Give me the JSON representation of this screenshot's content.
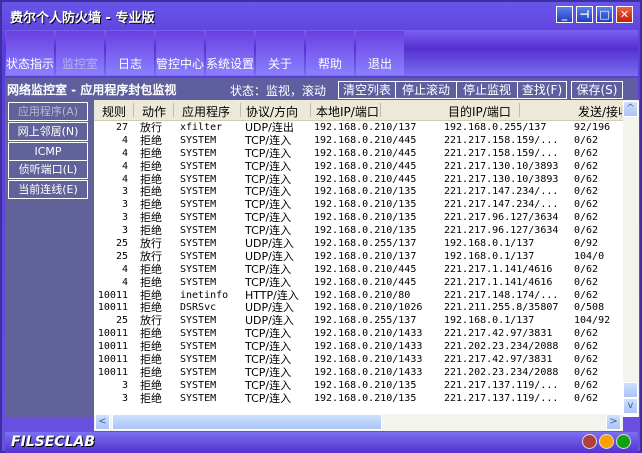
{
  "window": {
    "title": "费尔个人防火墙 - 专业版",
    "controls": [
      "minimize",
      "restore-alt",
      "maximize",
      "close"
    ]
  },
  "tabs": [
    {
      "label": "状态指示"
    },
    {
      "label": "监控室",
      "active": true
    },
    {
      "label": "日志"
    },
    {
      "label": "管控中心"
    },
    {
      "label": "系统设置"
    },
    {
      "label": "关于"
    },
    {
      "label": "帮助"
    },
    {
      "label": "退出"
    }
  ],
  "subheader": {
    "title": "网络监控室 - 应用程序封包监视",
    "status": "状态：监视，滚动",
    "buttons": [
      "清空列表",
      "停止滚动",
      "停止监视",
      "查找(F)",
      "保存(S)"
    ]
  },
  "left_menu": [
    {
      "label": "应用程序(A)",
      "active": true
    },
    {
      "label": "网上邻居(N)"
    },
    {
      "label": "ICMP"
    },
    {
      "label": "侦听端口(L)"
    },
    {
      "label": "当前连线(E)"
    }
  ],
  "table": {
    "columns": [
      "规则",
      "动作",
      "应用程序",
      "协议/方向",
      "本地IP/端口",
      "目的IP/端口",
      "发送/接收"
    ],
    "rows": [
      [
        "27",
        "放行",
        "xfilter",
        "UDP/连出",
        "192.168.0.210/137",
        "192.168.0.255/137",
        "92/196"
      ],
      [
        "4",
        "拒绝",
        "SYSTEM",
        "TCP/连入",
        "192.168.0.210/445",
        "221.217.158.159/...",
        "0/62"
      ],
      [
        "4",
        "拒绝",
        "SYSTEM",
        "TCP/连入",
        "192.168.0.210/445",
        "221.217.158.159/...",
        "0/62"
      ],
      [
        "4",
        "拒绝",
        "SYSTEM",
        "TCP/连入",
        "192.168.0.210/445",
        "221.217.130.10/3893",
        "0/62"
      ],
      [
        "4",
        "拒绝",
        "SYSTEM",
        "TCP/连入",
        "192.168.0.210/445",
        "221.217.130.10/3893",
        "0/62"
      ],
      [
        "3",
        "拒绝",
        "SYSTEM",
        "TCP/连入",
        "192.168.0.210/135",
        "221.217.147.234/...",
        "0/62"
      ],
      [
        "3",
        "拒绝",
        "SYSTEM",
        "TCP/连入",
        "192.168.0.210/135",
        "221.217.147.234/...",
        "0/62"
      ],
      [
        "3",
        "拒绝",
        "SYSTEM",
        "TCP/连入",
        "192.168.0.210/135",
        "221.217.96.127/3634",
        "0/62"
      ],
      [
        "3",
        "拒绝",
        "SYSTEM",
        "TCP/连入",
        "192.168.0.210/135",
        "221.217.96.127/3634",
        "0/62"
      ],
      [
        "25",
        "放行",
        "SYSTEM",
        "UDP/连入",
        "192.168.0.255/137",
        "192.168.0.1/137",
        "0/92"
      ],
      [
        "25",
        "放行",
        "SYSTEM",
        "UDP/连入",
        "192.168.0.210/137",
        "192.168.0.1/137",
        "104/0"
      ],
      [
        "4",
        "拒绝",
        "SYSTEM",
        "TCP/连入",
        "192.168.0.210/445",
        "221.217.1.141/4616",
        "0/62"
      ],
      [
        "4",
        "拒绝",
        "SYSTEM",
        "TCP/连入",
        "192.168.0.210/445",
        "221.217.1.141/4616",
        "0/62"
      ],
      [
        "10011",
        "拒绝",
        "inetinfo",
        "HTTP/连入",
        "192.168.0.210/80",
        "221.217.148.174/...",
        "0/62"
      ],
      [
        "10011",
        "拒绝",
        "DSRSvc",
        "UDP/连入",
        "192.168.0.210/1026",
        "221.211.255.8/35807",
        "0/508"
      ],
      [
        "25",
        "放行",
        "SYSTEM",
        "UDP/连入",
        "192.168.0.255/137",
        "192.168.0.1/137",
        "104/92"
      ],
      [
        "10011",
        "拒绝",
        "SYSTEM",
        "TCP/连入",
        "192.168.0.210/1433",
        "221.217.42.97/3831",
        "0/62"
      ],
      [
        "10011",
        "拒绝",
        "SYSTEM",
        "TCP/连入",
        "192.168.0.210/1433",
        "221.202.23.234/2088",
        "0/62"
      ],
      [
        "10011",
        "拒绝",
        "SYSTEM",
        "TCP/连入",
        "192.168.0.210/1433",
        "221.217.42.97/3831",
        "0/62"
      ],
      [
        "10011",
        "拒绝",
        "SYSTEM",
        "TCP/连入",
        "192.168.0.210/1433",
        "221.202.23.234/2088",
        "0/62"
      ],
      [
        "3",
        "拒绝",
        "SYSTEM",
        "TCP/连入",
        "192.168.0.210/135",
        "221.217.137.119/...",
        "0/62"
      ],
      [
        "3",
        "拒绝",
        "SYSTEM",
        "TCP/连入",
        "192.168.0.210/135",
        "221.217.137.119/...",
        "0/62"
      ]
    ]
  },
  "footer": {
    "logo": "FILSECLAB",
    "lights": [
      "#b04040",
      "#ffa000",
      "#10a010"
    ]
  }
}
